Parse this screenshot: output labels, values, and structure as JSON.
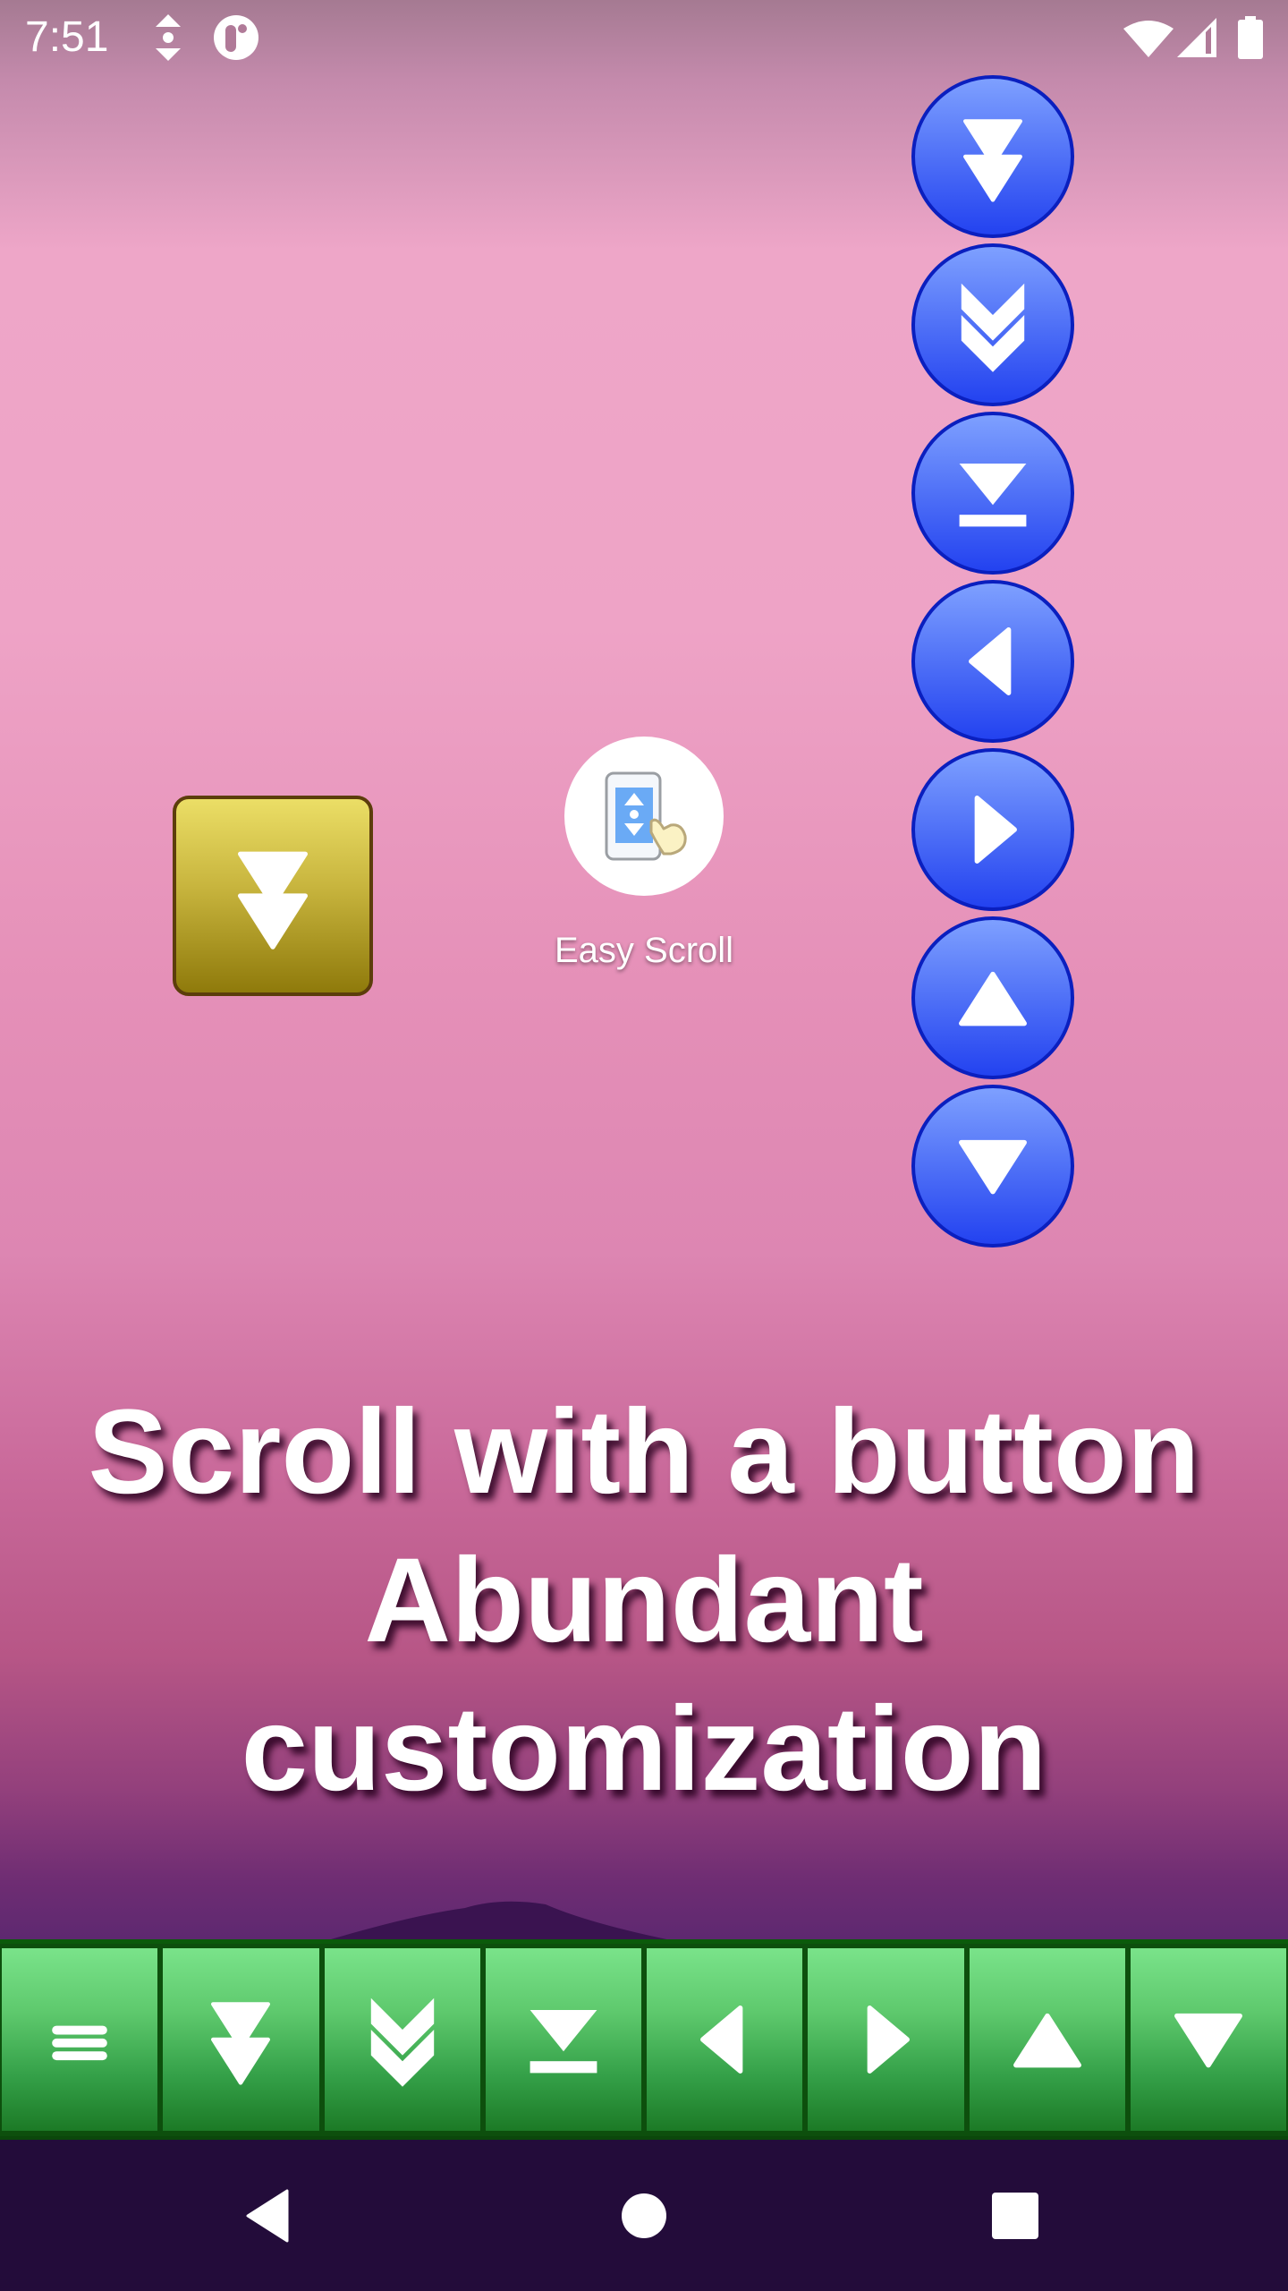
{
  "status_bar": {
    "time": "7:51",
    "left_icons": [
      "scroll-updown-icon",
      "app-notification-icon"
    ],
    "right_icons": [
      "wifi-icon",
      "cellular-signal-icon",
      "battery-icon"
    ]
  },
  "floating_buttons": {
    "color": "#3d5ef5",
    "border_color": "#0a1fbf",
    "items": [
      {
        "name": "page-down",
        "icon": "double-triangle-down-icon"
      },
      {
        "name": "fast-scroll-down",
        "icon": "double-chevron-down-icon"
      },
      {
        "name": "scroll-to-bottom",
        "icon": "scroll-to-bottom-icon"
      },
      {
        "name": "scroll-left",
        "icon": "triangle-left-icon"
      },
      {
        "name": "scroll-right",
        "icon": "triangle-right-icon"
      },
      {
        "name": "scroll-up",
        "icon": "triangle-up-icon"
      },
      {
        "name": "scroll-down",
        "icon": "triangle-down-icon"
      }
    ]
  },
  "yellow_button": {
    "icon": "double-triangle-down-icon",
    "color": "#c8b53e"
  },
  "app_icon": {
    "label": "Easy Scroll"
  },
  "headline": {
    "lines": [
      "Scroll with a button",
      "Abundant",
      "customization"
    ]
  },
  "toolbar": {
    "color": "#4cb85c",
    "items": [
      {
        "name": "menu",
        "icon": "menu-icon"
      },
      {
        "name": "page-down",
        "icon": "double-triangle-down-icon"
      },
      {
        "name": "fast-scroll-down",
        "icon": "double-chevron-down-icon"
      },
      {
        "name": "scroll-to-bottom",
        "icon": "scroll-to-bottom-icon"
      },
      {
        "name": "scroll-left",
        "icon": "triangle-left-icon"
      },
      {
        "name": "scroll-right",
        "icon": "triangle-right-icon"
      },
      {
        "name": "scroll-up",
        "icon": "triangle-up-icon"
      },
      {
        "name": "scroll-down",
        "icon": "triangle-down-icon"
      }
    ]
  },
  "nav_bar": {
    "items": [
      {
        "name": "back",
        "icon": "back-icon"
      },
      {
        "name": "home",
        "icon": "home-icon"
      },
      {
        "name": "recents",
        "icon": "recents-icon"
      }
    ]
  }
}
